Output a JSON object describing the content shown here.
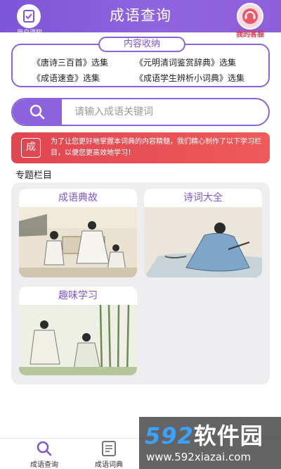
{
  "header": {
    "title": "成语查询",
    "left_label": "用户须知",
    "right_label": "我的客服",
    "left_icon": "notice-check-icon",
    "right_icon": "customer-service-icon",
    "accent_color": "#8c63dc"
  },
  "collection": {
    "caption": "内容收纳",
    "items": [
      "《唐诗三百首》选集",
      "《元明清词鉴赏辞典》选集",
      "《成语速查》选集",
      "《成语学生辨析小词典》选集"
    ]
  },
  "search": {
    "placeholder": "请输入成语关键词",
    "icon": "search-icon"
  },
  "notice": {
    "seal_text": "成",
    "text": "为了让您更好地掌握本词典的内容精髓，我们精心制作了以下学习栏目，以便您更高效地学习！",
    "color": "#e04650"
  },
  "section": {
    "title": "专题栏目",
    "cards": [
      {
        "title": "成语典故"
      },
      {
        "title": "诗词大全"
      },
      {
        "title": "趣味学习"
      }
    ]
  },
  "bottom_nav": {
    "tabs": [
      {
        "label": "成语查询",
        "icon": "search-icon"
      },
      {
        "label": "成语词典",
        "icon": "dictionary-icon"
      }
    ]
  },
  "watermark": {
    "number": "592",
    "brand": "软件园",
    "url": "www.592xiazai.com"
  }
}
